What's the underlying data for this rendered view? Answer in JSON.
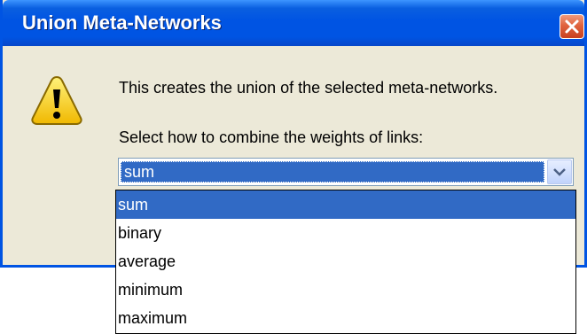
{
  "window": {
    "title": "Union Meta-Networks",
    "close_icon": "close-icon",
    "warning_icon": "warning-icon"
  },
  "message": "This creates the union of the selected meta-networks.",
  "prompt": "Select how to combine the weights of links:",
  "combo": {
    "selected_value": "sum",
    "arrow_icon": "chevron-down-icon"
  },
  "dropdown": {
    "options": [
      "sum",
      "binary",
      "average",
      "minimum",
      "maximum"
    ],
    "highlighted": "sum"
  },
  "colors": {
    "titlebar": "#0054e3",
    "dialog_bg": "#ece9d8",
    "selection": "#316ac5",
    "close_button": "#e0633e"
  }
}
